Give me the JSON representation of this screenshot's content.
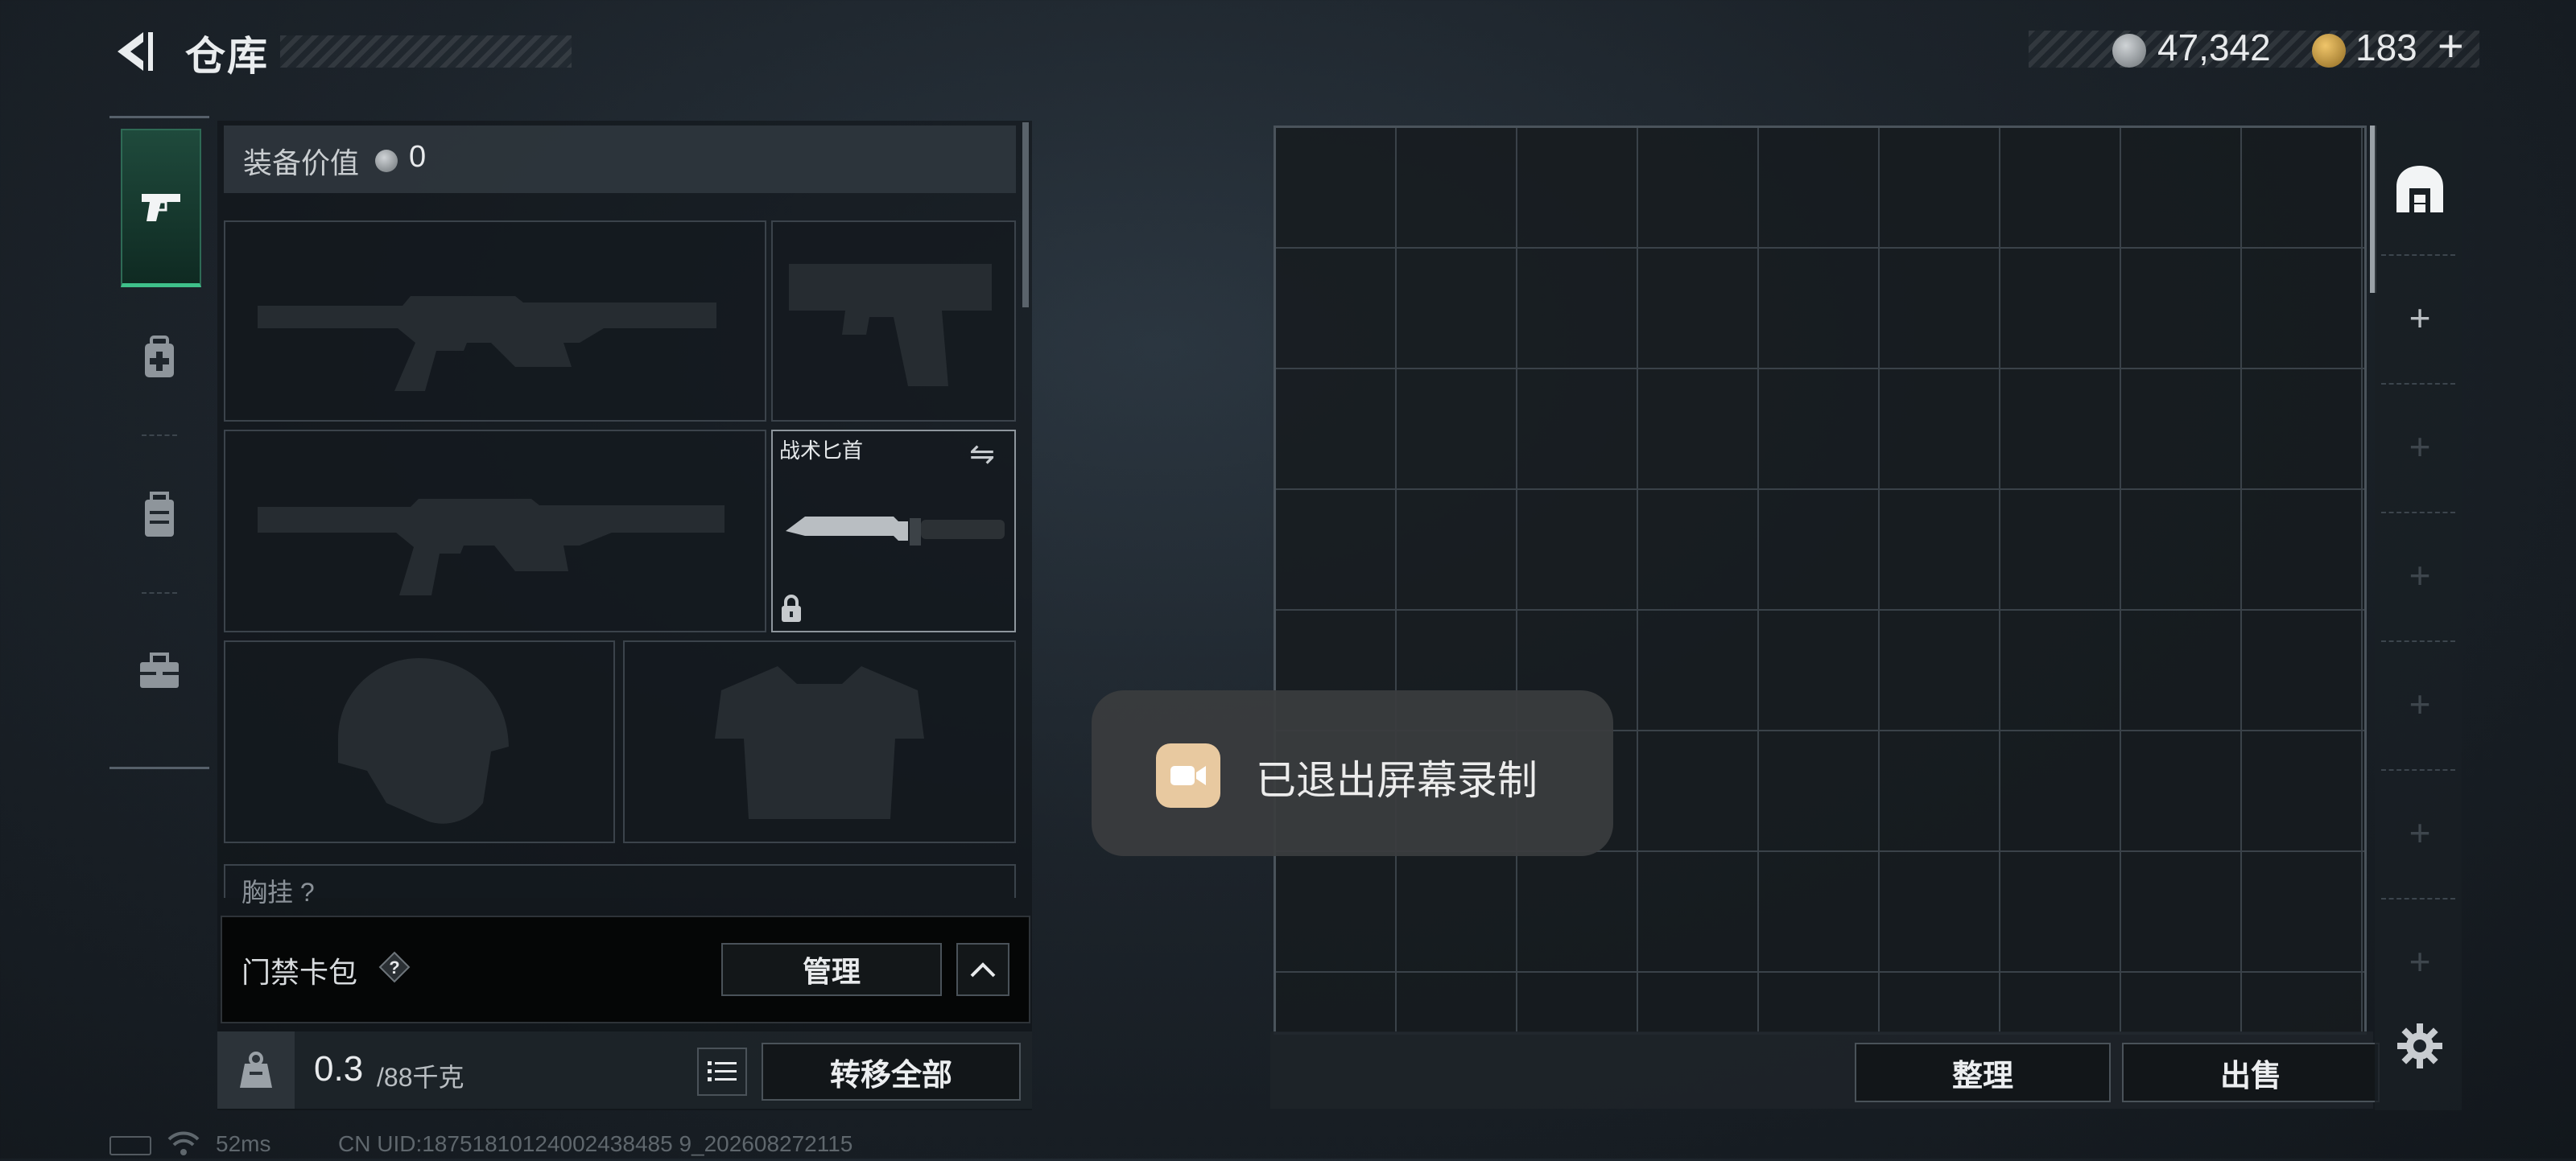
{
  "header": {
    "title": "仓库",
    "currency_primary": "47,342",
    "currency_secondary": "183",
    "add_label": "+"
  },
  "equipment": {
    "value_label": "装备价值",
    "value": "0",
    "knife_slot_label": "战术匕首",
    "chest_rig_label": "胸挂 ?"
  },
  "card_bag": {
    "label": "门禁卡包",
    "help": "?",
    "manage_label": "管理"
  },
  "weight": {
    "current": "0.3",
    "max": "/88千克"
  },
  "actions": {
    "move_all": "转移全部",
    "sort": "整理",
    "sell": "出售"
  },
  "toast": {
    "text": "已退出屏幕录制"
  },
  "status": {
    "ping": "52ms",
    "uid": "CN UID:18751810124002438485 9_202608272115"
  },
  "colors": {
    "accent_green": "#3fc08a",
    "toast_icon": "#e8c9a0",
    "coin_gold": "#d9a84a"
  }
}
